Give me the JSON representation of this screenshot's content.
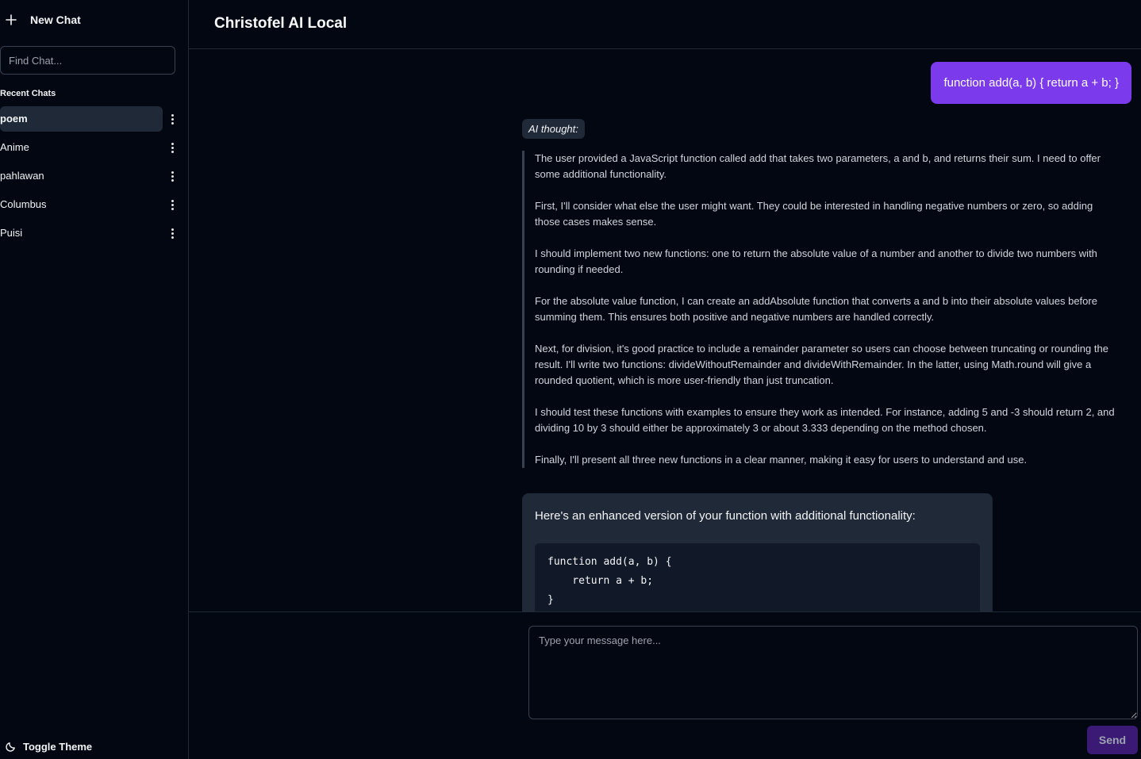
{
  "sidebar": {
    "new_chat_label": "New Chat",
    "search_placeholder": "Find Chat...",
    "recent_label": "Recent Chats",
    "chats": [
      {
        "label": "poem",
        "active": true
      },
      {
        "label": "Anime",
        "active": false
      },
      {
        "label": "pahlawan",
        "active": false
      },
      {
        "label": "Columbus",
        "active": false
      },
      {
        "label": "Puisi",
        "active": false
      }
    ],
    "toggle_theme_label": "Toggle Theme"
  },
  "header": {
    "title": "Christofel AI Local"
  },
  "messages": {
    "user_message": "function add(a, b) { return a + b; }",
    "thought_label": "AI thought:",
    "thought_paragraphs": [
      "The user provided a JavaScript function called add that takes two parameters, a and b, and returns their sum. I need to offer some additional functionality.",
      "First, I'll consider what else the user might want. They could be interested in handling negative numbers or zero, so adding those cases makes sense.",
      "I should implement two new functions: one to return the absolute value of a number and another to divide two numbers with rounding if needed.",
      "For the absolute value function, I can create an addAbsolute function that converts a and b into their absolute values before summing them. This ensures both positive and negative numbers are handled correctly.",
      "Next, for division, it's good practice to include a remainder parameter so users can choose between truncating or rounding the result. I'll write two functions: divideWithoutRemainder and divideWithRemainder. In the latter, using Math.round will give a rounded quotient, which is more user-friendly than just truncation.",
      "I should test these functions with examples to ensure they work as intended. For instance, adding 5 and -3 should return 2, and dividing 10 by 3 should either be approximately 3 or about 3.333 depending on the method chosen.",
      "Finally, I'll present all three new functions in a clear manner, making it easy for users to understand and use."
    ],
    "ai_intro": "Here's an enhanced version of your function with additional functionality:",
    "code": "function add(a, b) {\n    return a + b;\n}"
  },
  "input": {
    "placeholder": "Type your message here...",
    "send_label": "Send"
  },
  "colors": {
    "background": "#030712",
    "accent": "#7c3aed",
    "send_disabled": "#3b1a76",
    "panel": "#1f2937"
  }
}
